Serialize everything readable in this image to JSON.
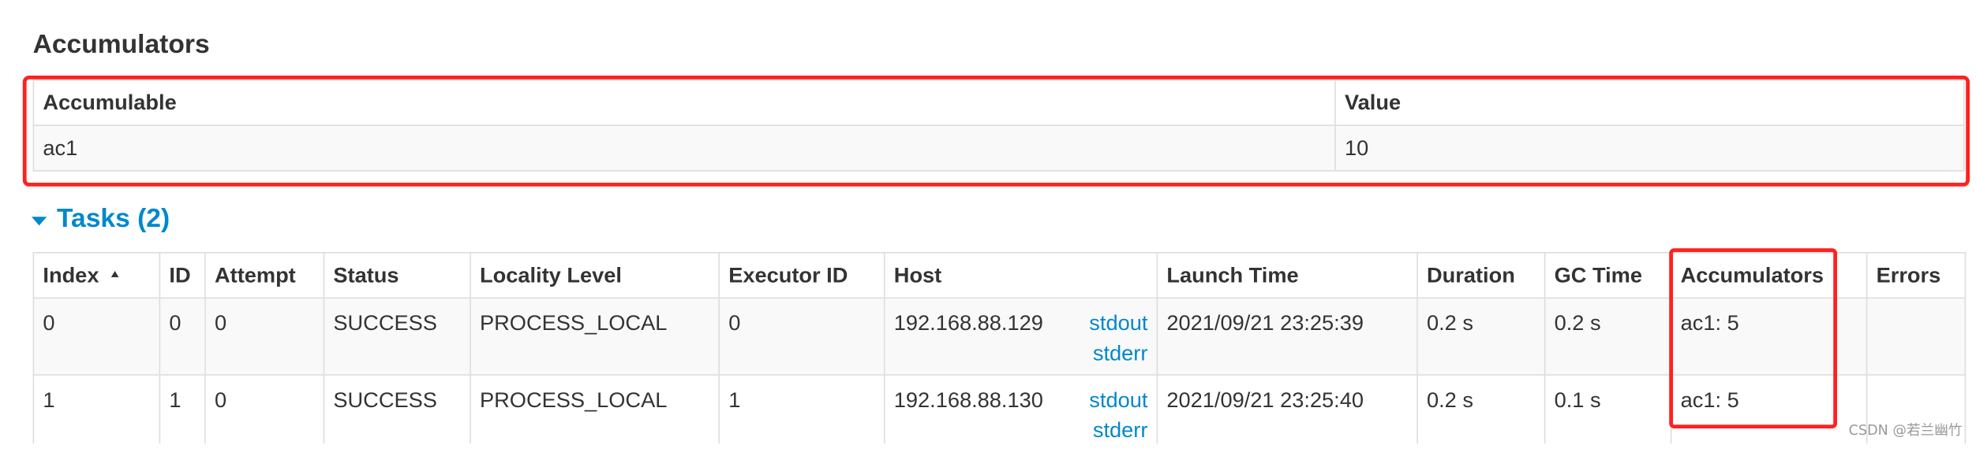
{
  "accumulators_section": {
    "title": "Accumulators",
    "headers": {
      "accumulable": "Accumulable",
      "value": "Value"
    },
    "rows": [
      {
        "accumulable": "ac1",
        "value": "10"
      }
    ]
  },
  "tasks_section": {
    "title": "Tasks (2)",
    "headers": {
      "index": "Index",
      "id": "ID",
      "attempt": "Attempt",
      "status": "Status",
      "locality_level": "Locality Level",
      "executor_id": "Executor ID",
      "host": "Host",
      "launch_time": "Launch Time",
      "duration": "Duration",
      "gc_time": "GC Time",
      "accumulators": "Accumulators",
      "errors": "Errors"
    },
    "rows": [
      {
        "index": "0",
        "id": "0",
        "attempt": "0",
        "status": "SUCCESS",
        "locality_level": "PROCESS_LOCAL",
        "executor_id": "0",
        "host": "192.168.88.129",
        "stdout": "stdout",
        "stderr": "stderr",
        "launch_time": "2021/09/21 23:25:39",
        "duration": "0.2 s",
        "gc_time": "0.2 s",
        "accumulators": "ac1: 5",
        "errors": ""
      },
      {
        "index": "1",
        "id": "1",
        "attempt": "0",
        "status": "SUCCESS",
        "locality_level": "PROCESS_LOCAL",
        "executor_id": "1",
        "host": "192.168.88.130",
        "stdout": "stdout",
        "stderr": "stderr",
        "launch_time": "2021/09/21 23:25:40",
        "duration": "0.2 s",
        "gc_time": "0.1 s",
        "accumulators": "ac1: 5",
        "errors": ""
      }
    ]
  },
  "watermark": "CSDN @若兰幽竹",
  "colors": {
    "link": "#0088cc",
    "highlight": "#ff2121",
    "text": "#333333",
    "border": "#dddddd"
  }
}
